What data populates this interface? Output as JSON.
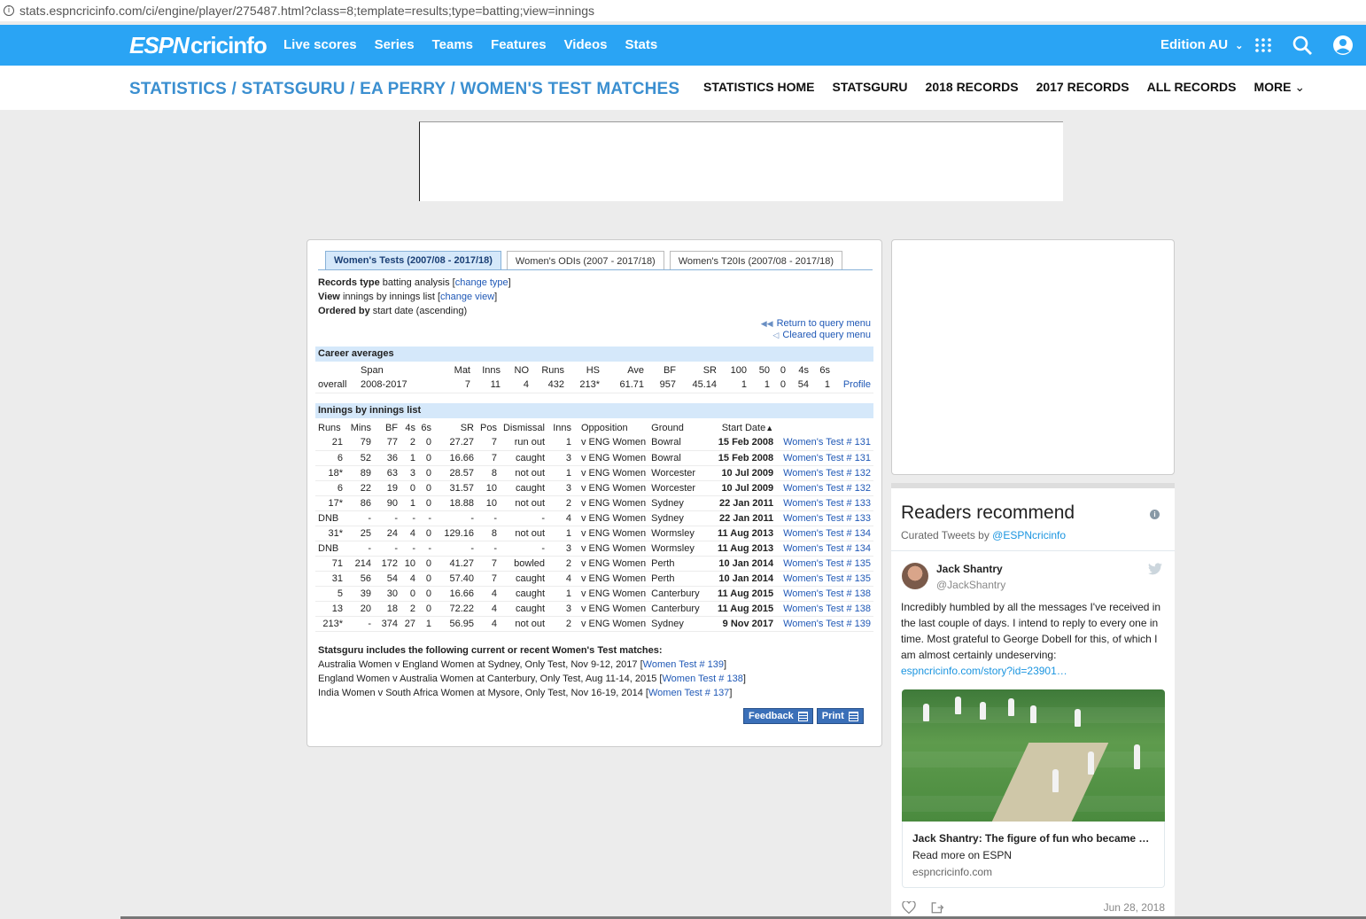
{
  "browser": {
    "url": "stats.espncricinfo.com/ci/engine/player/275487.html?class=8;template=results;type=batting;view=innings"
  },
  "topnav": {
    "logo_espn": "ESPN",
    "logo_cricinfo": "cricinfo",
    "links": [
      "Live scores",
      "Series",
      "Teams",
      "Features",
      "Videos",
      "Stats"
    ],
    "edition": "Edition AU"
  },
  "subnav": {
    "breadcrumb": "STATISTICS / STATSGURU / EA PERRY / WOMEN'S TEST MATCHES",
    "links": [
      "STATISTICS HOME",
      "STATSGURU",
      "2018 RECORDS",
      "2017 RECORDS",
      "ALL RECORDS",
      "MORE"
    ]
  },
  "tabs": [
    "Women's Tests (2007/08 - 2017/18)",
    "Women's ODIs (2007 - 2017/18)",
    "Women's T20Is (2007/08 - 2017/18)"
  ],
  "meta": {
    "records_label": "Records type",
    "records_value": "batting analysis",
    "change_type": "change type",
    "view_label": "View",
    "view_value": "innings by innings list",
    "change_view": "change view",
    "ordered_label": "Ordered by",
    "ordered_value": "start date (ascending)",
    "return_query": "Return to query menu",
    "cleared_query": "Cleared query menu"
  },
  "career": {
    "title": "Career averages",
    "headers": [
      "",
      "Span",
      "Mat",
      "Inns",
      "NO",
      "Runs",
      "HS",
      "Ave",
      "BF",
      "SR",
      "100",
      "50",
      "0",
      "4s",
      "6s",
      ""
    ],
    "row": [
      "overall",
      "2008-2017",
      "7",
      "11",
      "4",
      "432",
      "213*",
      "61.71",
      "957",
      "45.14",
      "1",
      "1",
      "0",
      "54",
      "1",
      "Profile"
    ]
  },
  "innings": {
    "title": "Innings by innings list",
    "headers": [
      "Runs",
      "Mins",
      "BF",
      "4s",
      "6s",
      "SR",
      "Pos",
      "Dismissal",
      "Inns",
      "Opposition",
      "Ground",
      "Start Date",
      ""
    ],
    "sort_indicator": "▲",
    "rows": [
      [
        "21",
        "79",
        "77",
        "2",
        "0",
        "27.27",
        "7",
        "run out",
        "1",
        "v ENG Women",
        "Bowral",
        "15 Feb 2008",
        "Women's Test # 131"
      ],
      [
        "6",
        "52",
        "36",
        "1",
        "0",
        "16.66",
        "7",
        "caught",
        "3",
        "v ENG Women",
        "Bowral",
        "15 Feb 2008",
        "Women's Test # 131"
      ],
      [
        "18*",
        "89",
        "63",
        "3",
        "0",
        "28.57",
        "8",
        "not out",
        "1",
        "v ENG Women",
        "Worcester",
        "10 Jul 2009",
        "Women's Test # 132"
      ],
      [
        "6",
        "22",
        "19",
        "0",
        "0",
        "31.57",
        "10",
        "caught",
        "3",
        "v ENG Women",
        "Worcester",
        "10 Jul 2009",
        "Women's Test # 132"
      ],
      [
        "17*",
        "86",
        "90",
        "1",
        "0",
        "18.88",
        "10",
        "not out",
        "2",
        "v ENG Women",
        "Sydney",
        "22 Jan 2011",
        "Women's Test # 133"
      ],
      [
        "DNB",
        "-",
        "-",
        "-",
        "-",
        "-",
        "-",
        "-",
        "4",
        "v ENG Women",
        "Sydney",
        "22 Jan 2011",
        "Women's Test # 133"
      ],
      [
        "31*",
        "25",
        "24",
        "4",
        "0",
        "129.16",
        "8",
        "not out",
        "1",
        "v ENG Women",
        "Wormsley",
        "11 Aug 2013",
        "Women's Test # 134"
      ],
      [
        "DNB",
        "-",
        "-",
        "-",
        "-",
        "-",
        "-",
        "-",
        "3",
        "v ENG Women",
        "Wormsley",
        "11 Aug 2013",
        "Women's Test # 134"
      ],
      [
        "71",
        "214",
        "172",
        "10",
        "0",
        "41.27",
        "7",
        "bowled",
        "2",
        "v ENG Women",
        "Perth",
        "10 Jan 2014",
        "Women's Test # 135"
      ],
      [
        "31",
        "56",
        "54",
        "4",
        "0",
        "57.40",
        "7",
        "caught",
        "4",
        "v ENG Women",
        "Perth",
        "10 Jan 2014",
        "Women's Test # 135"
      ],
      [
        "5",
        "39",
        "30",
        "0",
        "0",
        "16.66",
        "4",
        "caught",
        "1",
        "v ENG Women",
        "Canterbury",
        "11 Aug 2015",
        "Women's Test # 138"
      ],
      [
        "13",
        "20",
        "18",
        "2",
        "0",
        "72.22",
        "4",
        "caught",
        "3",
        "v ENG Women",
        "Canterbury",
        "11 Aug 2015",
        "Women's Test # 138"
      ],
      [
        "213*",
        "-",
        "374",
        "27",
        "1",
        "56.95",
        "4",
        "not out",
        "2",
        "v ENG Women",
        "Sydney",
        "9 Nov 2017",
        "Women's Test # 139"
      ]
    ]
  },
  "footnote": {
    "heading": "Statsguru includes the following current or recent Women's Test matches:",
    "matches": [
      {
        "text": "Australia Women v England Women at Sydney, Only Test, Nov 9-12, 2017",
        "link": "Women Test # 139"
      },
      {
        "text": "England Women v Australia Women at Canterbury, Only Test, Aug 11-14, 2015",
        "link": "Women Test # 138"
      },
      {
        "text": "India Women v South Africa Women at Mysore, Only Test, Nov 16-19, 2014",
        "link": "Women Test # 137"
      }
    ]
  },
  "buttons": {
    "feedback": "Feedback",
    "print": "Print"
  },
  "tweets": {
    "title": "Readers recommend",
    "curated_prefix": "Curated Tweets by ",
    "curated_handle": "@ESPNcricinfo",
    "author_name": "Jack Shantry",
    "author_handle": "@JackShantry",
    "text": "Incredibly humbled by all the messages I've received in the last couple of days. I intend to reply to every one in time. Most grateful to George Dobell for this, of which I am almost certainly undeserving:",
    "link": "espncricinfo.com/story?id=23901…",
    "card_title": "Jack Shantry: The figure of fun who became …",
    "card_sub": "Read more on ESPN",
    "card_domain": "espncricinfo.com",
    "date": "Jun 28, 2018"
  },
  "colors": {
    "brand_blue": "#2aa4f4",
    "link_blue": "#1f58b6",
    "header_bg": "#d5e8fa"
  }
}
